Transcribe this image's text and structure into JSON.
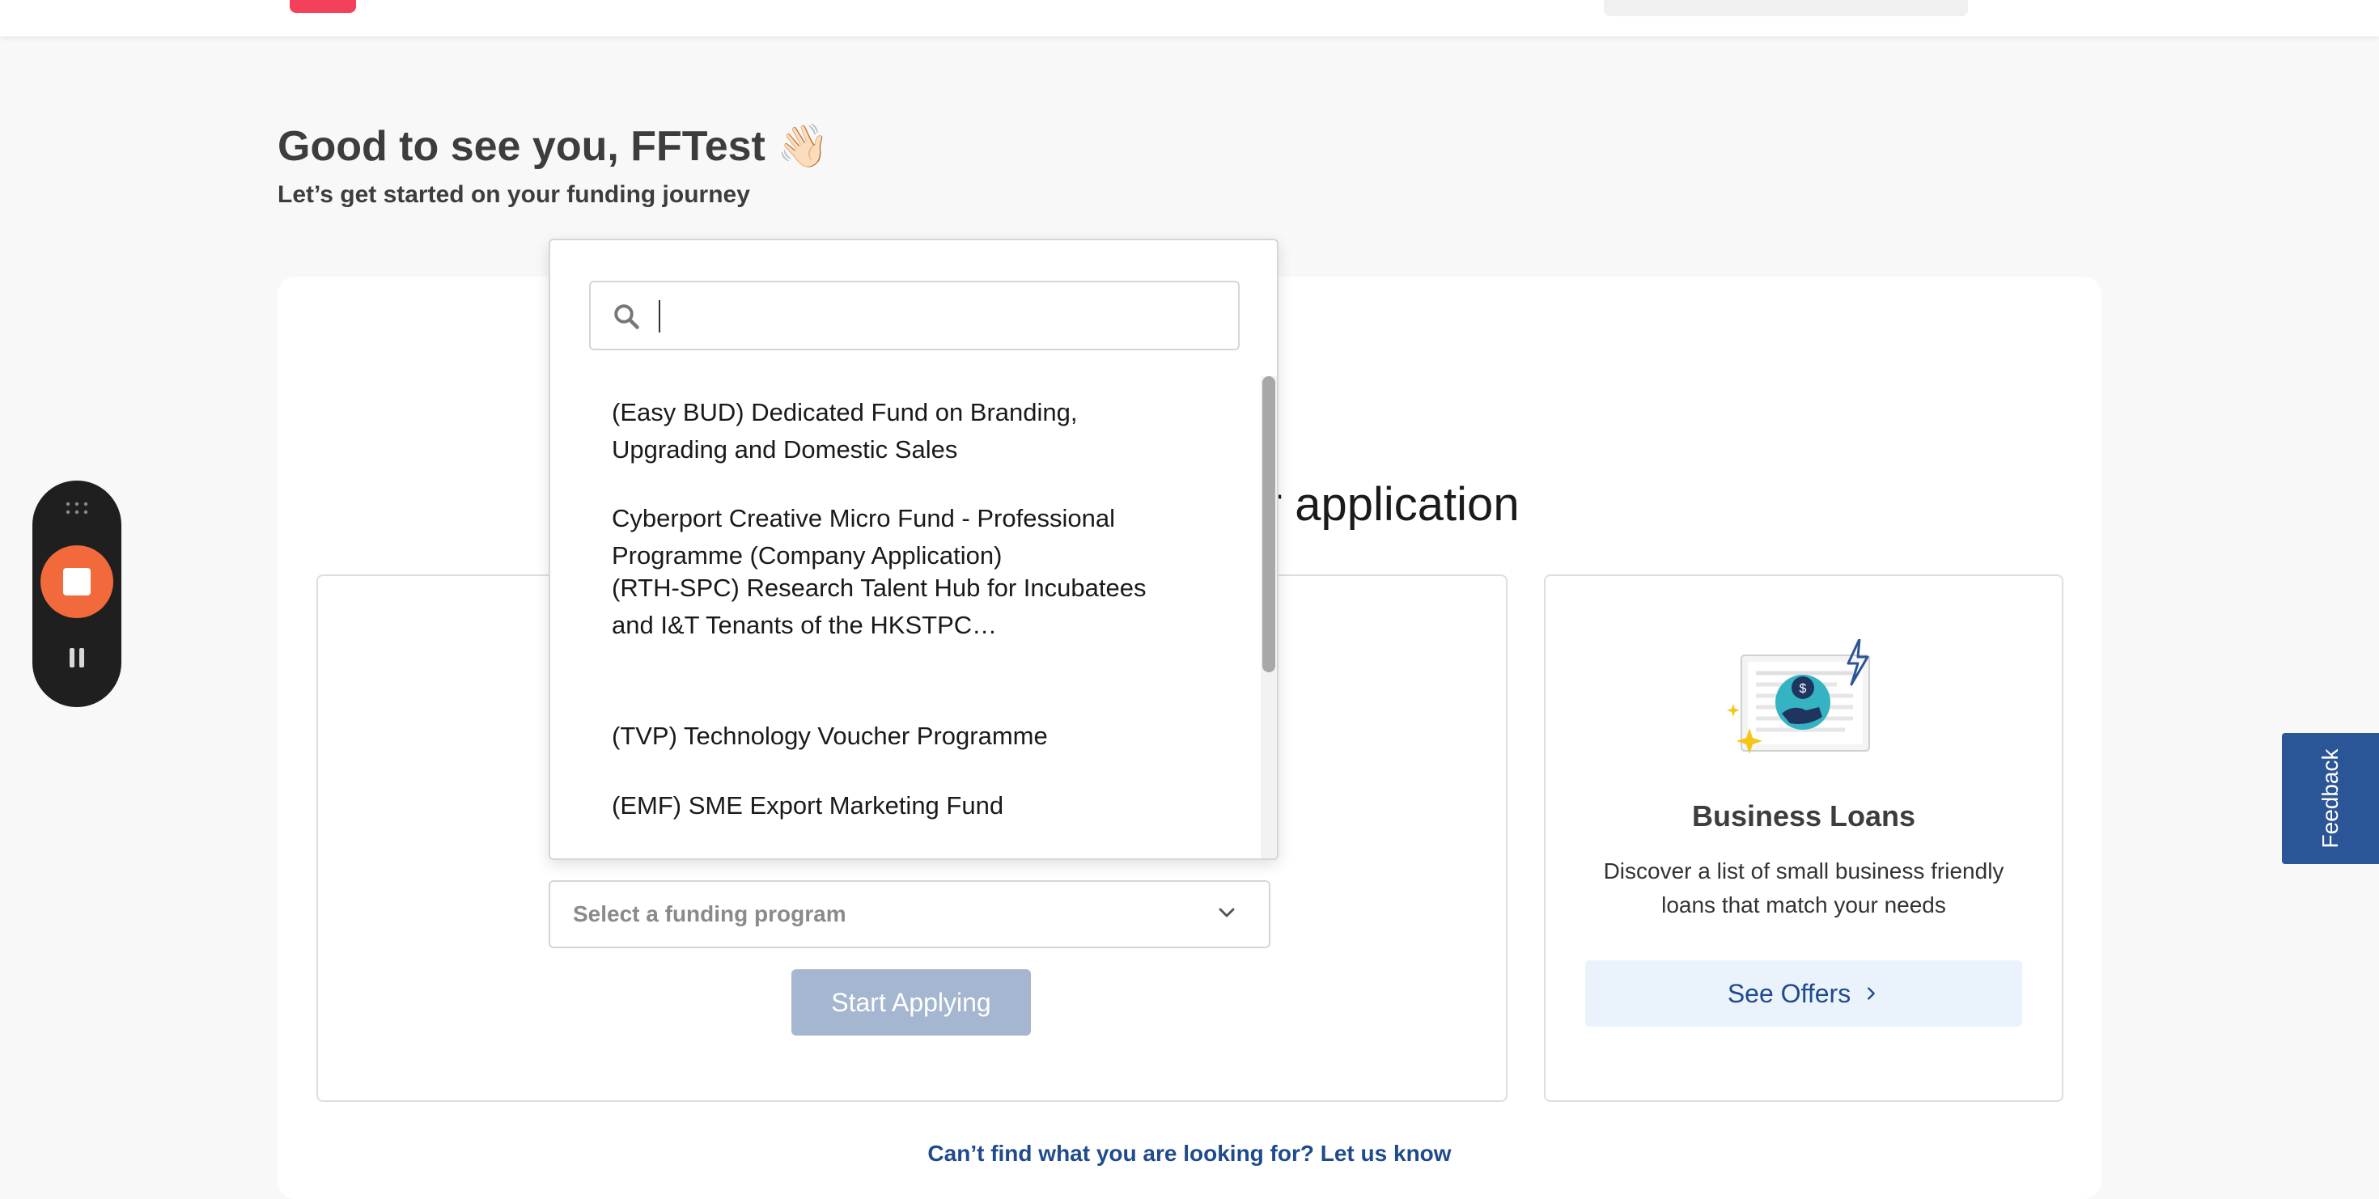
{
  "greeting": {
    "title": "Good to see you, FFTest 👋🏻",
    "subtitle": "Let’s get started on your funding journey"
  },
  "section": {
    "title_visible_part": "start your application"
  },
  "grants": {
    "select_placeholder": "Select a funding program",
    "start_button": "Start Applying",
    "dropdown": {
      "search_value": "",
      "options": [
        "(Easy BUD) Dedicated Fund on Branding, Upgrading and Domestic Sales",
        "Cyberport Creative Micro Fund - Professional Programme (Company Application)",
        "(RTH-SPC) Research Talent Hub for Incubatees and I&T Tenants of the HKSTPC…",
        "(TVP) Technology Voucher Programme",
        "(EMF) SME Export Marketing Fund"
      ]
    }
  },
  "loans": {
    "title": "Business Loans",
    "description": "Discover a list of small business friendly loans that match your needs",
    "button": "See Offers"
  },
  "help_link": "Can’t find what you are looking for? Let us know",
  "feedback": "Feedback",
  "colors": {
    "accent_blue": "#1f4a8c",
    "start_disabled": "#a5b6d0",
    "record_orange": "#f26a3b",
    "feedback_blue": "#2a5596",
    "logo_red": "#f4415b"
  }
}
